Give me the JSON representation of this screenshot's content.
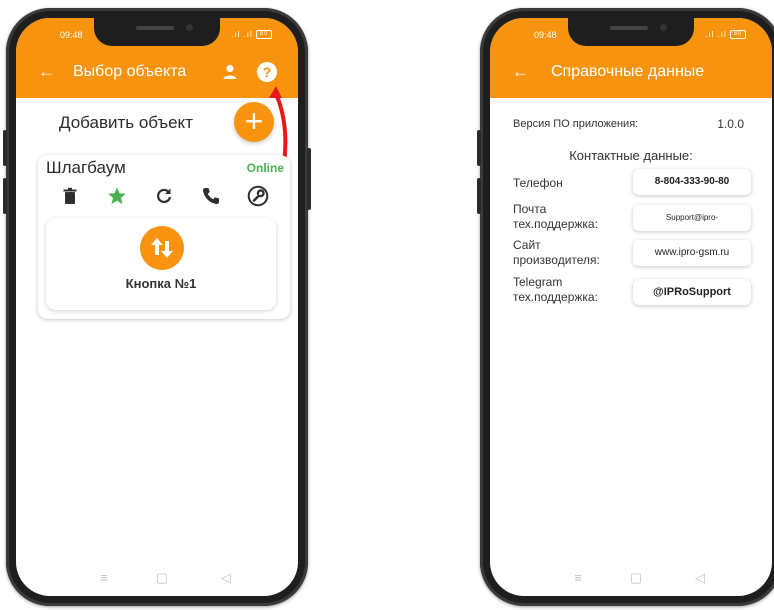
{
  "left_screen": {
    "status": {
      "time": "09:48",
      "signal": ".ıl .ıl",
      "battery": "80"
    },
    "appbar": {
      "title": "Выбор объекта"
    },
    "add_object_label": "Добавить объект",
    "add_button_symbol": "+",
    "object_card": {
      "name": "Шлагбаум",
      "status": "Online",
      "actions": [
        "trash-icon",
        "star-icon",
        "refresh-icon",
        "phone-icon",
        "wrench-icon"
      ],
      "key": {
        "label": "Кнопка №1"
      }
    },
    "nav": [
      "≡",
      "▢",
      "◁"
    ]
  },
  "right_screen": {
    "status": {
      "time": "09:48",
      "signal": ".ıl .ıl",
      "battery": "80"
    },
    "appbar": {
      "title": "Справочные данные"
    },
    "version": {
      "label": "Версия ПО приложения:",
      "value": "1.0.0"
    },
    "contacts_title": "Контактные данные:",
    "contacts": [
      {
        "label": "Телефон",
        "value": "8-804-333-90-80"
      },
      {
        "label": "Почта тех.поддержка:",
        "value": "Support@ipro-"
      },
      {
        "label": "Сайт производителя:",
        "value": "www.ipro-gsm.ru"
      },
      {
        "label": "Telegram тех.поддержка:",
        "value": "@IPRoSupport"
      }
    ],
    "nav": [
      "≡",
      "▢",
      "◁"
    ]
  },
  "colors": {
    "accent": "#f7930e",
    "online": "#4caf50",
    "star": "#4caf50"
  }
}
